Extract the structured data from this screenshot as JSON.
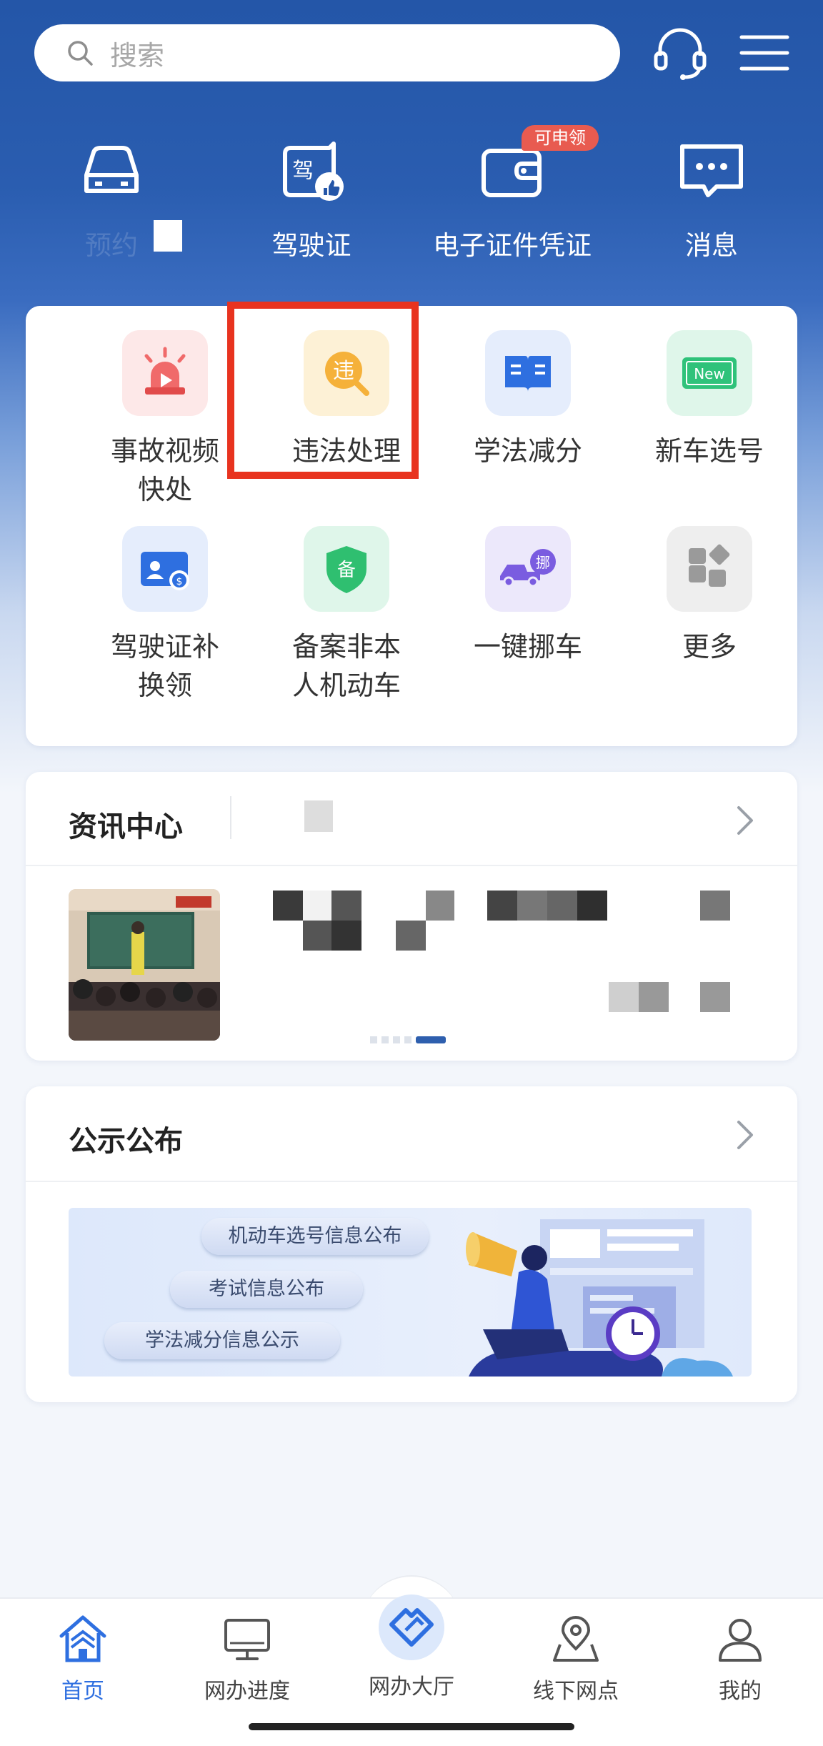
{
  "search": {
    "placeholder": "搜索"
  },
  "top_shortcuts": [
    {
      "label": "预约",
      "icon": "car-icon"
    },
    {
      "label": "驾驶证",
      "icon": "license-icon"
    },
    {
      "label": "电子证件凭证",
      "icon": "wallet-icon",
      "badge": "可申领"
    },
    {
      "label": "消息",
      "icon": "message-icon"
    }
  ],
  "services": [
    {
      "label": "事故视频快处",
      "icon": "siren-icon",
      "color": "#f06a6a"
    },
    {
      "label": "违法处理",
      "icon": "violation-search-icon",
      "glyph": "违",
      "color": "#f5b13a"
    },
    {
      "label": "学法减分",
      "icon": "book-icon",
      "color": "#2e6fe0"
    },
    {
      "label": "新车选号",
      "icon": "new-plate-icon",
      "glyph": "New",
      "color": "#2fc27a"
    },
    {
      "label": "驾驶证补换领",
      "icon": "id-card-icon",
      "color": "#2e6fe0"
    },
    {
      "label": "备案非本人机动车",
      "icon": "shield-icon",
      "glyph": "备",
      "color": "#2fbf70"
    },
    {
      "label": "一键挪车",
      "icon": "tow-truck-icon",
      "glyph": "挪",
      "color": "#7a5ce0"
    },
    {
      "label": "更多",
      "icon": "grid-more-icon",
      "color": "#9a9a9a"
    }
  ],
  "news": {
    "title": "资讯中心"
  },
  "notice": {
    "title": "公示公布",
    "items": [
      "机动车选号信息公布",
      "考试信息公布",
      "学法减分信息公示"
    ]
  },
  "nav": [
    {
      "label": "首页",
      "icon": "home-icon",
      "active": true
    },
    {
      "label": "网办进度",
      "icon": "monitor-icon"
    },
    {
      "label": "网办大厅",
      "icon": "hall-icon"
    },
    {
      "label": "线下网点",
      "icon": "map-pin-icon"
    },
    {
      "label": "我的",
      "icon": "user-icon"
    }
  ],
  "colors": {
    "primary": "#2456a8",
    "accent": "#2e6fe0",
    "highlight": "#e8331f",
    "badge": "#e85b50"
  }
}
